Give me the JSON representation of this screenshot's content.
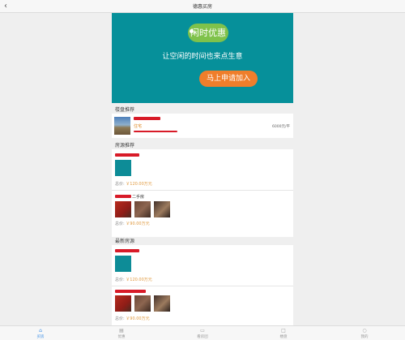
{
  "header": {
    "title": "德惠买房",
    "back_icon": "back-arrow-icon"
  },
  "banner": {
    "badge": "闲时优惠",
    "text": "让空闲的时间也来点生意",
    "cta": "马上申请加入",
    "colors": {
      "background": "#06909a",
      "badge": "#7fc24b",
      "cta": "#ef7e2b"
    }
  },
  "sections": {
    "building_recommend": {
      "title": "楼盘推荐",
      "item": {
        "tag": "住宅",
        "price": "6000元/平"
      }
    },
    "listing_recommend": {
      "title": "房源推荐",
      "items": [
        {
          "price_label": "总价:",
          "price_value": "￥120.00万元"
        },
        {
          "tag": "二手房",
          "price_label": "总价:",
          "price_value": "￥90.00万元"
        }
      ]
    },
    "latest_listings": {
      "title": "最新房源",
      "items": [
        {
          "price_label": "总价:",
          "price_value": "￥120.00万元"
        },
        {
          "price_label": "总价:",
          "price_value": "￥90.00万元"
        }
      ]
    }
  },
  "tabbar": {
    "items": [
      {
        "label": "买房",
        "icon": "home-icon",
        "active": true
      },
      {
        "label": "优惠",
        "icon": "discount-icon",
        "active": false
      },
      {
        "label": "看房团",
        "icon": "group-icon",
        "active": false
      },
      {
        "label": "楼盘",
        "icon": "building-icon",
        "active": false
      },
      {
        "label": "我的",
        "icon": "user-icon",
        "active": false
      }
    ]
  }
}
